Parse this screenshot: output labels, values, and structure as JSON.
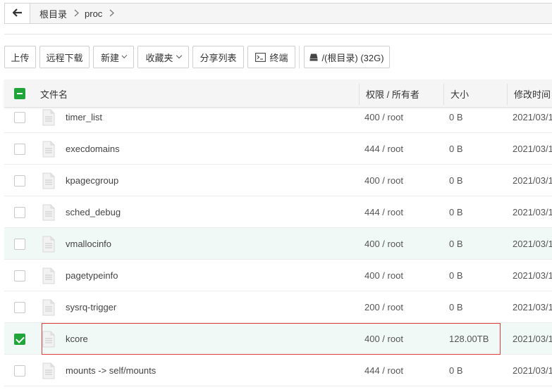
{
  "path": {
    "crumbs": [
      "根目录",
      "proc"
    ]
  },
  "toolbar": {
    "upload": "上传",
    "remote_download": "远程下载",
    "new": "新建",
    "favorites": "收藏夹",
    "share_list": "分享列表",
    "terminal": "终端",
    "disk": "/(根目录) (32G)"
  },
  "table": {
    "headers": {
      "name": "文件名",
      "perm": "权限 / 所有者",
      "size": "大小",
      "mtime": "修改时间"
    },
    "rows": [
      {
        "name": "timer_list",
        "perm": "400 / root",
        "size": "0 B",
        "mtime": "2021/03/1"
      },
      {
        "name": "execdomains",
        "perm": "444 / root",
        "size": "0 B",
        "mtime": "2021/03/1"
      },
      {
        "name": "kpagecgroup",
        "perm": "400 / root",
        "size": "0 B",
        "mtime": "2021/03/1"
      },
      {
        "name": "sched_debug",
        "perm": "444 / root",
        "size": "0 B",
        "mtime": "2021/03/1"
      },
      {
        "name": "vmallocinfo",
        "perm": "400 / root",
        "size": "0 B",
        "mtime": "2021/03/1"
      },
      {
        "name": "pagetypeinfo",
        "perm": "400 / root",
        "size": "0 B",
        "mtime": "2021/03/1"
      },
      {
        "name": "sysrq-trigger",
        "perm": "200 / root",
        "size": "0 B",
        "mtime": "2021/03/1"
      },
      {
        "name": "kcore",
        "perm": "400 / root",
        "size": "128.00TB",
        "mtime": "2021/03/1"
      },
      {
        "name": "mounts -> self/mounts",
        "perm": "444 / root",
        "size": "0 B",
        "mtime": "2021/03/1"
      }
    ]
  },
  "colors": {
    "accent": "#20a53a",
    "selection_border": "#e03c3c",
    "row_highlight": "#f1f9f6"
  }
}
